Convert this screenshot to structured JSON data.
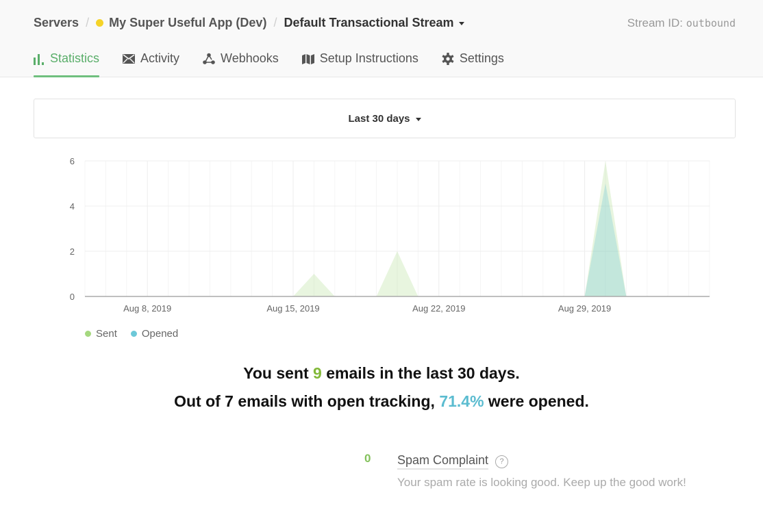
{
  "header": {
    "breadcrumb": {
      "servers": "Servers",
      "separator": "/",
      "server_name": "My Super Useful App (Dev)",
      "server_status_color": "#f5d328",
      "stream_name": "Default Transactional Stream"
    },
    "stream_id_label": "Stream ID:",
    "stream_id_value": "outbound"
  },
  "tabs": [
    {
      "label": "Statistics",
      "icon": "bar-chart-icon",
      "active": true
    },
    {
      "label": "Activity",
      "icon": "envelope-icon",
      "active": false
    },
    {
      "label": "Webhooks",
      "icon": "webhook-icon",
      "active": false
    },
    {
      "label": "Setup Instructions",
      "icon": "map-icon",
      "active": false
    },
    {
      "label": "Settings",
      "icon": "gear-icon",
      "active": false
    }
  ],
  "range_selector": {
    "label": "Last 30 days"
  },
  "colors": {
    "accent_green": "#6fbf7e",
    "sent": "#a5d87f",
    "opened": "#6cc8d8",
    "highlight_green": "#83b93a",
    "highlight_teal": "#5bbcd0"
  },
  "chart_data": {
    "type": "area",
    "title": "",
    "xlabel": "",
    "ylabel": "",
    "ylim": [
      0,
      6
    ],
    "yticks": [
      "0",
      "2",
      "4",
      "6"
    ],
    "grid": true,
    "legend_position": "bottom-left",
    "x": [
      "Aug 5",
      "Aug 6",
      "Aug 7",
      "Aug 8",
      "Aug 9",
      "Aug 10",
      "Aug 11",
      "Aug 12",
      "Aug 13",
      "Aug 14",
      "Aug 15",
      "Aug 16",
      "Aug 17",
      "Aug 18",
      "Aug 19",
      "Aug 20",
      "Aug 21",
      "Aug 22",
      "Aug 23",
      "Aug 24",
      "Aug 25",
      "Aug 26",
      "Aug 27",
      "Aug 28",
      "Aug 29",
      "Aug 30",
      "Aug 31",
      "Sep 1",
      "Sep 2",
      "Sep 3",
      "Sep 4"
    ],
    "xtick_labels": [
      {
        "index": 3,
        "label": "Aug 8, 2019"
      },
      {
        "index": 10,
        "label": "Aug 15, 2019"
      },
      {
        "index": 17,
        "label": "Aug 22, 2019"
      },
      {
        "index": 24,
        "label": "Aug 29, 2019"
      }
    ],
    "series": [
      {
        "name": "Sent",
        "color": "#a5d87f",
        "values": [
          0,
          0,
          0,
          0,
          0,
          0,
          0,
          0,
          0,
          0,
          0,
          1,
          0,
          0,
          0,
          2,
          0,
          0,
          0,
          0,
          0,
          0,
          0,
          0,
          0,
          6,
          0,
          0,
          0,
          0,
          0
        ]
      },
      {
        "name": "Opened",
        "color": "#6cc8d8",
        "values": [
          0,
          0,
          0,
          0,
          0,
          0,
          0,
          0,
          0,
          0,
          0,
          0,
          0,
          0,
          0,
          0,
          0,
          0,
          0,
          0,
          0,
          0,
          0,
          0,
          0,
          5,
          0,
          0,
          0,
          0,
          0
        ]
      }
    ]
  },
  "summary": {
    "line1_pre": "You sent ",
    "sent_count": "9",
    "line1_post": " emails in the last 30 days.",
    "line2_pre": "Out of 7 emails with open tracking, ",
    "open_rate": "71.4%",
    "line2_post": " were opened."
  },
  "spam": {
    "count": "0",
    "title": "Spam Complaint",
    "help": "?",
    "description": "Your spam rate is looking good. Keep up the good work!"
  }
}
